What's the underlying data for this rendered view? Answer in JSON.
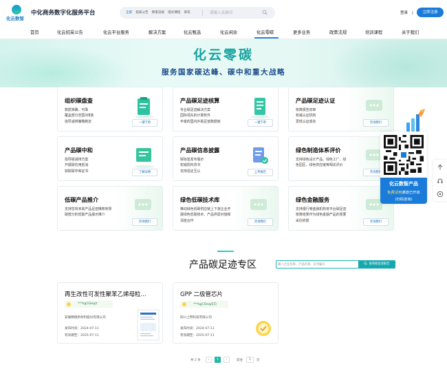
{
  "header": {
    "logo_text": "化云数智",
    "site_title": "中化商务数字化服务平台",
    "search": {
      "tabs": [
        "全部",
        "招采公告",
        "政策法规",
        "培训课程",
        "资讯"
      ],
      "placeholder": "请输入关键词"
    },
    "login_label": "登录",
    "login_sep": "|",
    "register_label": "立即注册"
  },
  "nav": {
    "items": [
      "首页",
      "化云招采公告",
      "化云平台服务",
      "解决方案",
      "化云甄选",
      "化云闲余",
      "化云零碳",
      "更多业务",
      "政策法规",
      "培训课程",
      "关于我们"
    ],
    "active": "化云零碳"
  },
  "banner": {
    "title": "化云零碳",
    "subtitle": "服务国家碳达峰、碳中和重大战略"
  },
  "services": [
    {
      "title": "组织碳盘查",
      "desc": [
        "数据准确、可靠",
        "覆盖部分范围3排放",
        "指导减排策略制定"
      ],
      "button": "一键下单"
    },
    {
      "title": "产品碳足迹核算",
      "desc": [
        "专业碳足迹解决方案",
        "国际领先的计算软件",
        "丰富的国内外碳足迹数据库"
      ],
      "button": "一键下单"
    },
    {
      "title": "产品碳足迹认证",
      "desc": [
        "核算报告初审",
        "权威认证机构",
        "更低认证成本"
      ],
      "button": "咨询我们"
    },
    {
      "title": "产品碳中和",
      "desc": [
        "指导碳减排方案",
        "开展碳信用抵消",
        "获取碳中和证书"
      ],
      "button": "了解详情"
    },
    {
      "title": "产品碳信息披露",
      "desc": [
        "碳标签发布展示",
        "权威机构背书",
        "支持验证互认"
      ],
      "button": "上传报告"
    },
    {
      "title": "绿色制造体系评价",
      "desc": [
        "支持绿色设计产品、绿色工厂、绿",
        "色园区、绿色供应链等相关评价"
      ],
      "button": "咨询我们"
    },
    {
      "title": "低碳产品推介",
      "desc": [
        "支持您将未来产品足迹推荐到零",
        "碳部分的低碳产品展示推介"
      ],
      "button": "咨询我们"
    },
    {
      "title": "绿色低碳技术库",
      "desc": [
        "推动绿色低碳供应链上下游企业开",
        "展绿色低碳技术、产品供需对接和",
        "深度合作"
      ],
      "button": "咨询我们"
    },
    {
      "title": "绿色金融服务",
      "desc": [
        "支持银行等金融机构将平台碳足迹",
        "核算结果作为绿色金融产品的重要",
        "采信依据"
      ],
      "button": "咨询我们"
    }
  ],
  "qr_panel": {
    "title": "化云数智产品",
    "free_trial": "免费试用",
    "trial_suffix": "通道已开启",
    "scan_hint": "(扫码咨询)"
  },
  "footprint": {
    "section_title": "产品碳足迹专区",
    "search_placeholder": "输入企业名称、产品名称、证书编号",
    "search_button": "查询碳足迹报告",
    "products": [
      {
        "title": "再生改性可发性聚苯乙烯母粒...",
        "code": "***kgCOeq/t",
        "company": "安徽精德新材料股份有限公司",
        "publish": "发布时间：2024-07-11",
        "valid": "有效期至：2025-07-11"
      },
      {
        "title": "GPP 二极管芯片",
        "code": "***kgCOeq/E只",
        "company": "四川上特科技有限公司",
        "publish": "发布时间：2024-07-11",
        "valid": "有效期至：2025-07-11"
      }
    ]
  },
  "pagination": {
    "total": "共 2 条",
    "prev": "‹",
    "current": "1",
    "next": "›",
    "goto": "前往",
    "page_input": "1",
    "page_unit": "页"
  },
  "colors": {
    "primary": "#1a7cd8",
    "teal": "#17a3a0",
    "banner_sub": "#1a4a8a"
  }
}
